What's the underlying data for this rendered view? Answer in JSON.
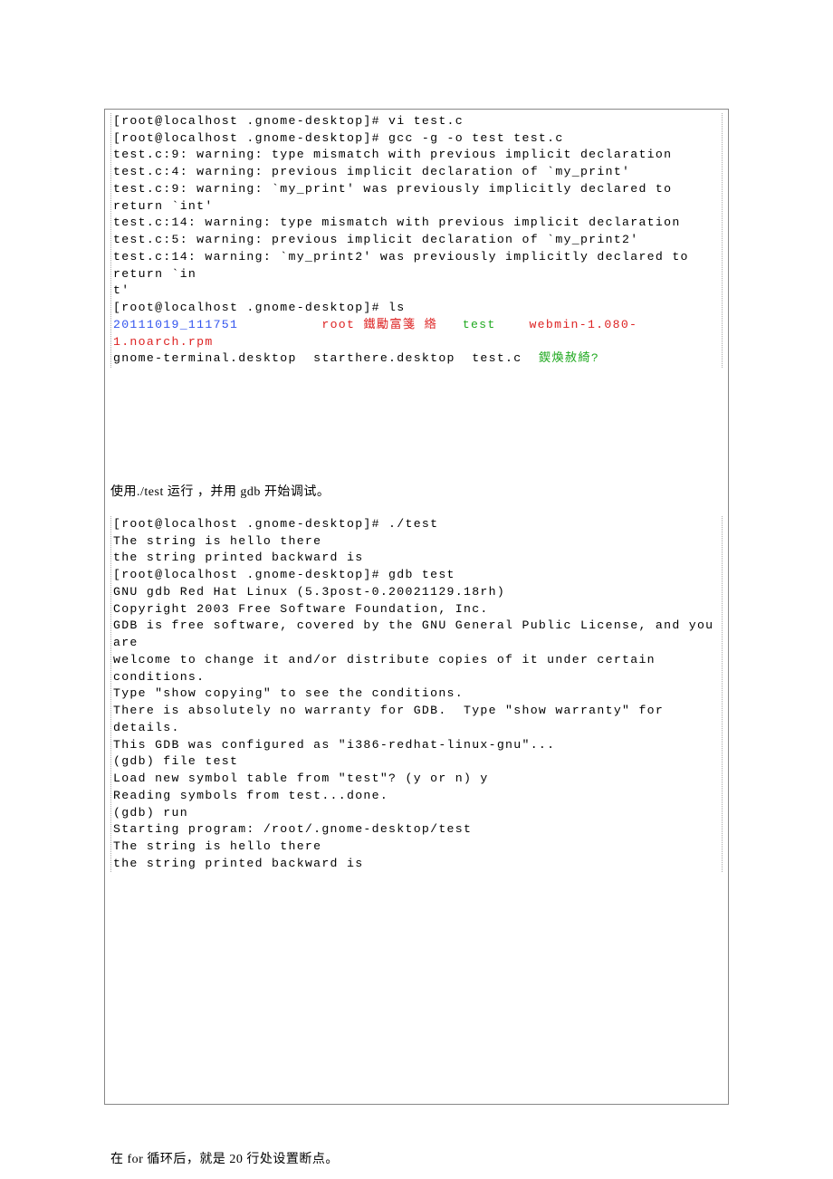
{
  "block1": {
    "line1": "[root@localhost .gnome-desktop]# vi test.c",
    "line2": "[root@localhost .gnome-desktop]# gcc -g -o test test.c",
    "line3": "test.c:9: warning: type mismatch with previous implicit declaration",
    "line4": "test.c:4: warning: previous implicit declaration of `my_print'",
    "line5": "test.c:9: warning: `my_print' was previously implicitly declared to return `int'",
    "line6": "test.c:14: warning: type mismatch with previous implicit declaration",
    "line7": "test.c:5: warning: previous implicit declaration of `my_print2'",
    "line8": "test.c:14: warning: `my_print2' was previously implicitly declared to return `in",
    "line9": "t'",
    "line10": "[root@localhost .gnome-desktop]# ls",
    "ls_blue1": "20111019_111751",
    "ls_gap1": "          ",
    "ls_red": "root 鐵勵富箋 綹",
    "ls_gap2": "   ",
    "ls_green": "test",
    "ls_gap3": "    ",
    "ls_magenta": "webmin-1.080-1.noarch.rpm",
    "line12a": "gnome-terminal.desktop  starthere.desktop  test.c  ",
    "line12b": "鍥煥赦綺?"
  },
  "prose1": "使用./test 运行 ，并用 gdb 开始调试。",
  "block2": {
    "line1": "[root@localhost .gnome-desktop]# ./test",
    "line2": "The string is hello there",
    "line3": "the string printed backward is",
    "line4": "[root@localhost .gnome-desktop]# gdb test",
    "line5": "GNU gdb Red Hat Linux (5.3post-0.20021129.18rh)",
    "line6": "Copyright 2003 Free Software Foundation, Inc.",
    "line7": "GDB is free software, covered by the GNU General Public License, and you are",
    "line8": "welcome to change it and/or distribute copies of it under certain conditions.",
    "line9": "Type \"show copying\" to see the conditions.",
    "line10": "There is absolutely no warranty for GDB.  Type \"show warranty\" for details.",
    "line11": "This GDB was configured as \"i386-redhat-linux-gnu\"...",
    "line12": "(gdb) file test",
    "line13": "Load new symbol table from \"test\"? (y or n) y",
    "line14": "Reading symbols from test...done.",
    "line15": "(gdb) run",
    "line16": "Starting program: /root/.gnome-desktop/test",
    "line17": "The string is hello there",
    "line18": "the string printed backward is"
  },
  "prose2": "在 for 循环后，就是 20 行处设置断点。"
}
